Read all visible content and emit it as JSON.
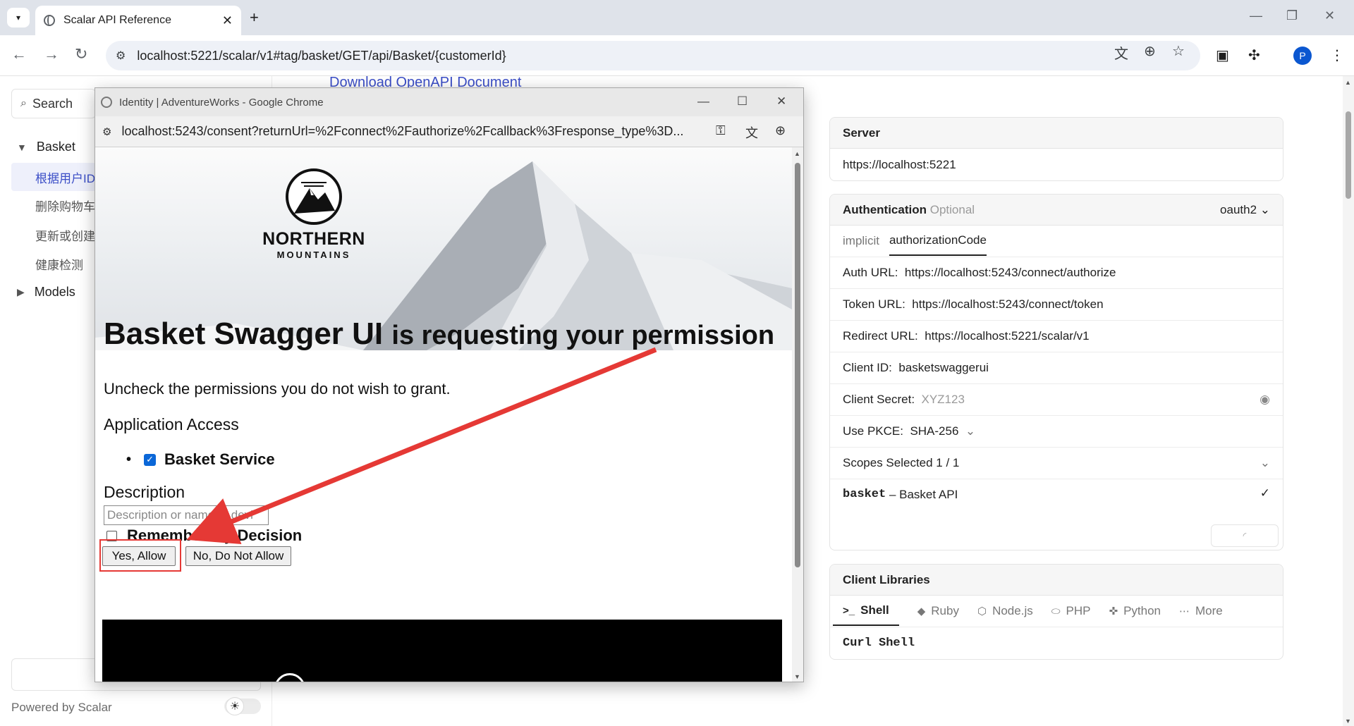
{
  "browser": {
    "tab_title": "Scalar API Reference",
    "url": "localhost:5221/scalar/v1#tag/basket/GET/api/Basket/{customerId}",
    "profile_initial": "P"
  },
  "sidebar": {
    "search_label": "Search",
    "group_label": "Basket",
    "items": [
      "根据用户ID",
      "删除购物车",
      "更新或创建",
      "健康检测"
    ],
    "models_label": "Models",
    "powered_by": "Powered by Scalar"
  },
  "main": {
    "download_link": "Download OpenAPI Document"
  },
  "server": {
    "title": "Server",
    "url": "https://localhost:5221"
  },
  "auth": {
    "title": "Authentication",
    "optional": "Optional",
    "scheme": "oauth2",
    "flows": [
      "implicit",
      "authorizationCode"
    ],
    "auth_url_label": "Auth URL:",
    "auth_url": "https://localhost:5243/connect/authorize",
    "token_url_label": "Token URL:",
    "token_url": "https://localhost:5243/connect/token",
    "redirect_url_label": "Redirect URL:",
    "redirect_url": "https://localhost:5221/scalar/v1",
    "client_id_label": "Client ID:",
    "client_id": "basketswaggerui",
    "client_secret_label": "Client Secret:",
    "client_secret": "XYZ123",
    "pkce_label": "Use PKCE:",
    "pkce_value": "SHA-256",
    "scopes_selected": "Scopes Selected 1 / 1",
    "scope_name": "basket",
    "scope_desc": "– Basket API"
  },
  "client_libraries": {
    "title": "Client Libraries",
    "tabs": [
      "Shell",
      "Ruby",
      "Node.js",
      "PHP",
      "Python",
      "More"
    ],
    "code_label": "Curl Shell"
  },
  "popup": {
    "window_title": "Identity | AdventureWorks - Google Chrome",
    "url": "localhost:5243/consent?returnUrl=%2Fconnect%2Fauthorize%2Fcallback%3Fresponse_type%3D...",
    "logo_line1": "NORTHERN",
    "logo_line2": "MOUNTAINS",
    "client_name": "Basket Swagger UI",
    "request_text": "is requesting your permission",
    "uncheck_text": "Uncheck the permissions you do not wish to grant.",
    "app_access": "Application Access",
    "scope_label": "Basket Service",
    "description_label": "Description",
    "description_placeholder": "Description or name of devi",
    "remember_label": "Remember My Decision",
    "allow_button": "Yes, Allow",
    "deny_button": "No, Do Not Allow"
  },
  "colors": {
    "accent": "#3b4ec7",
    "highlight": "#e53935",
    "checkbox": "#0b67d8"
  }
}
